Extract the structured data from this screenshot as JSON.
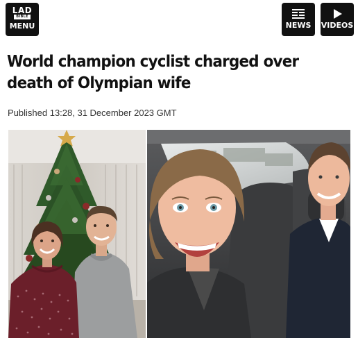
{
  "header": {
    "logo": {
      "line1": "LAD",
      "line2": "BIBLE",
      "menu_label": "MENU",
      "icon": "ladbible-logo"
    },
    "news": {
      "label": "NEWS",
      "icon": "news-icon"
    },
    "videos": {
      "label": "VIDEOS",
      "icon": "play-icon"
    }
  },
  "article": {
    "headline": "World champion cyclist charged over death of Olympian wife",
    "published": "Published 13:28, 31 December 2023 GMT"
  },
  "photos": [
    {
      "name": "couple-christmas-tree-photo"
    },
    {
      "name": "couple-car-selfie-photo"
    }
  ],
  "colors": {
    "header_button_bg": "#111111",
    "headline_text": "#111111",
    "meta_text": "#333333"
  }
}
